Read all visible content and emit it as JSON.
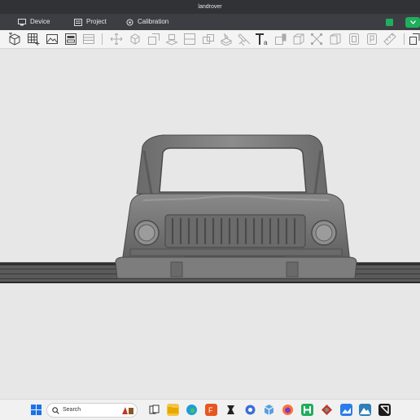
{
  "window": {
    "title": "landrover"
  },
  "menu": {
    "device": "Device",
    "project": "Project",
    "calibration": "Calibration"
  },
  "taskbar": {
    "search_placeholder": "Search"
  },
  "colors": {
    "titlebar": "#303236",
    "menubar": "#3c3e44",
    "toolbar": "#f4f4f4",
    "viewport": "#e7e7e7",
    "model": "#7a7a7a",
    "accent_green": "#1fae5c"
  },
  "toolbar_icons": [
    "add-model-icon",
    "grid-arrange-icon",
    "import-image-icon",
    "slice-preview-icon",
    "layers-icon",
    "move-icon",
    "scale-icon",
    "rotate-icon",
    "mirror-icon",
    "support-icon",
    "paint-icon",
    "text-icon",
    "cut-icon",
    "hollow-icon",
    "measure-icon",
    "split-icon",
    "repair-icon",
    "drill-icon",
    "more-icon"
  ]
}
